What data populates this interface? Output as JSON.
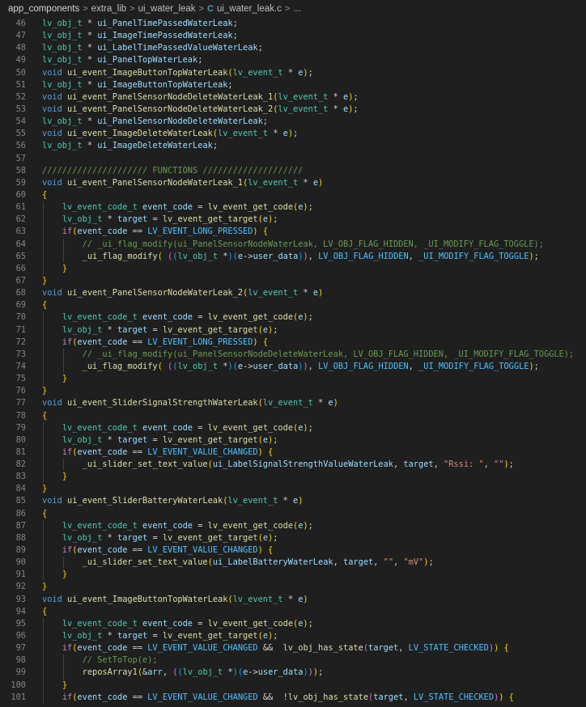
{
  "breadcrumb": {
    "items": [
      "app_components",
      "extra_lib",
      "ui_water_leak",
      "ui_water_leak.c",
      "..."
    ],
    "file_icon": "C"
  },
  "colors": {
    "background": "#1f1f1f",
    "keyword": "#569cd6",
    "type": "#4ec9b0",
    "function": "#dcdcaa",
    "variable": "#9cdcfe",
    "macro": "#4fc1ff",
    "comment": "#6a9955",
    "string": "#ce9178",
    "control": "#c586c0"
  },
  "code_lines": [
    {
      "n": "46",
      "t": "lv_obj_t * ui_PanelTimePassedWaterLeak;"
    },
    {
      "n": "47",
      "t": "lv_obj_t * ui_ImageTimePassedWaterLeak;"
    },
    {
      "n": "48",
      "t": "lv_obj_t * ui_LabelTimePassedValueWaterLeak;"
    },
    {
      "n": "49",
      "t": "lv_obj_t * ui_PanelTopWaterLeak;"
    },
    {
      "n": "50",
      "t": "void ui_event_ImageButtonTopWaterLeak(lv_event_t * e);"
    },
    {
      "n": "51",
      "t": "lv_obj_t * ui_ImageButtonTopWaterLeak;"
    },
    {
      "n": "52",
      "t": "void ui_event_PanelSensorNodeDeleteWaterLeak_1(lv_event_t * e);"
    },
    {
      "n": "53",
      "t": "void ui_event_PanelSensorNodeDeleteWaterLeak_2(lv_event_t * e);"
    },
    {
      "n": "54",
      "t": "lv_obj_t * ui_PanelSensorNodeDeleteWaterLeak;"
    },
    {
      "n": "55",
      "t": "void ui_event_ImageDeleteWaterLeak(lv_event_t * e);"
    },
    {
      "n": "56",
      "t": "lv_obj_t * ui_ImageDeleteWaterLeak;"
    },
    {
      "n": "57",
      "t": ""
    },
    {
      "n": "58",
      "t": "///////////////////// FUNCTIONS ////////////////////"
    },
    {
      "n": "59",
      "t": "void ui_event_PanelSensorNodeWaterLeak_1(lv_event_t * e)"
    },
    {
      "n": "60",
      "t": "{"
    },
    {
      "n": "61",
      "t": "    lv_event_code_t event_code = lv_event_get_code(e);"
    },
    {
      "n": "62",
      "t": "    lv_obj_t * target = lv_event_get_target(e);"
    },
    {
      "n": "63",
      "t": "    if(event_code == LV_EVENT_LONG_PRESSED) {"
    },
    {
      "n": "64",
      "t": "        // _ui_flag_modify(ui_PanelSensorNodeWaterLeak, LV_OBJ_FLAG_HIDDEN, _UI_MODIFY_FLAG_TOGGLE);"
    },
    {
      "n": "65",
      "t": "        _ui_flag_modify( ((lv_obj_t *)(e->user_data)), LV_OBJ_FLAG_HIDDEN, _UI_MODIFY_FLAG_TOGGLE);"
    },
    {
      "n": "66",
      "t": "    }"
    },
    {
      "n": "67",
      "t": "}"
    },
    {
      "n": "68",
      "t": "void ui_event_PanelSensorNodeWaterLeak_2(lv_event_t * e)"
    },
    {
      "n": "69",
      "t": "{"
    },
    {
      "n": "70",
      "t": "    lv_event_code_t event_code = lv_event_get_code(e);"
    },
    {
      "n": "71",
      "t": "    lv_obj_t * target = lv_event_get_target(e);"
    },
    {
      "n": "72",
      "t": "    if(event_code == LV_EVENT_LONG_PRESSED) {"
    },
    {
      "n": "73",
      "t": "        // _ui_flag_modify(ui_PanelSensorNodeDeleteWaterLeak, LV_OBJ_FLAG_HIDDEN, _UI_MODIFY_FLAG_TOGGLE);"
    },
    {
      "n": "74",
      "t": "        _ui_flag_modify( ((lv_obj_t *)(e->user_data)), LV_OBJ_FLAG_HIDDEN, _UI_MODIFY_FLAG_TOGGLE);"
    },
    {
      "n": "75",
      "t": "    }"
    },
    {
      "n": "76",
      "t": "}"
    },
    {
      "n": "77",
      "t": "void ui_event_SliderSignalStrengthWaterLeak(lv_event_t * e)"
    },
    {
      "n": "78",
      "t": "{"
    },
    {
      "n": "79",
      "t": "    lv_event_code_t event_code = lv_event_get_code(e);"
    },
    {
      "n": "80",
      "t": "    lv_obj_t * target = lv_event_get_target(e);"
    },
    {
      "n": "81",
      "t": "    if(event_code == LV_EVENT_VALUE_CHANGED) {"
    },
    {
      "n": "82",
      "t": "        _ui_slider_set_text_value(ui_LabelSignalStrengthValueWaterLeak, target, \"Rssi: \", \"\");"
    },
    {
      "n": "83",
      "t": "    }"
    },
    {
      "n": "84",
      "t": "}"
    },
    {
      "n": "85",
      "t": "void ui_event_SliderBatteryWaterLeak(lv_event_t * e)"
    },
    {
      "n": "86",
      "t": "{"
    },
    {
      "n": "87",
      "t": "    lv_event_code_t event_code = lv_event_get_code(e);"
    },
    {
      "n": "88",
      "t": "    lv_obj_t * target = lv_event_get_target(e);"
    },
    {
      "n": "89",
      "t": "    if(event_code == LV_EVENT_VALUE_CHANGED) {"
    },
    {
      "n": "90",
      "t": "        _ui_slider_set_text_value(ui_LabelBatteryWaterLeak, target, \"\", \"mV\");"
    },
    {
      "n": "91",
      "t": "    }"
    },
    {
      "n": "92",
      "t": "}"
    },
    {
      "n": "93",
      "t": "void ui_event_ImageButtonTopWaterLeak(lv_event_t * e)"
    },
    {
      "n": "94",
      "t": "{"
    },
    {
      "n": "95",
      "t": "    lv_event_code_t event_code = lv_event_get_code(e);"
    },
    {
      "n": "96",
      "t": "    lv_obj_t * target = lv_event_get_target(e);"
    },
    {
      "n": "97",
      "t": "    if(event_code == LV_EVENT_VALUE_CHANGED &&  lv_obj_has_state(target, LV_STATE_CHECKED)) {"
    },
    {
      "n": "98",
      "t": "        // SetToTop(e);"
    },
    {
      "n": "99",
      "t": "        reposArray1(&arr, ((lv_obj_t *)(e->user_data)));"
    },
    {
      "n": "100",
      "t": "    }"
    },
    {
      "n": "101",
      "t": "    if(event_code == LV_EVENT_VALUE_CHANGED &&  !lv_obj_has_state(target, LV_STATE_CHECKED)) {"
    }
  ]
}
